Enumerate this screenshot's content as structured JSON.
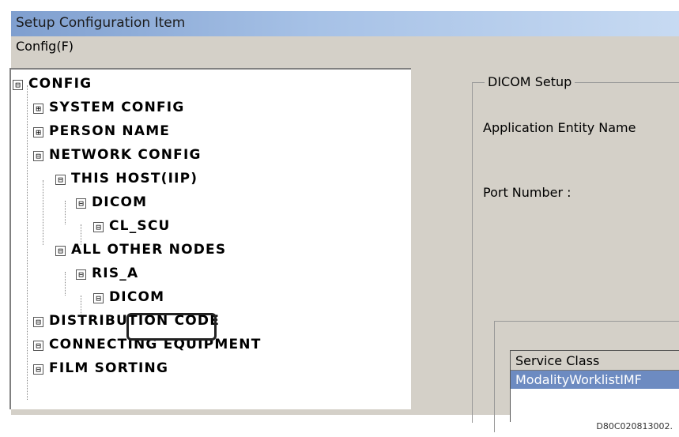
{
  "window": {
    "title": "Setup Configuration Item"
  },
  "menu": {
    "config_label": "Config(F)"
  },
  "tree": {
    "nodes": [
      {
        "label": "CONFIG",
        "expander": "⊟"
      },
      {
        "label": "SYSTEM CONFIG",
        "expander": "⊞"
      },
      {
        "label": "PERSON NAME",
        "expander": "⊞"
      },
      {
        "label": "NETWORK CONFIG",
        "expander": "⊟"
      },
      {
        "label": "THIS HOST(IIP)",
        "expander": "⊟"
      },
      {
        "label": "DICOM",
        "expander": "⊟"
      },
      {
        "label": "CL_SCU",
        "expander": "⊟"
      },
      {
        "label": "ALL OTHER NODES",
        "expander": "⊟"
      },
      {
        "label": "RIS_A",
        "expander": "⊟"
      },
      {
        "label": "DICOM",
        "expander": "⊟"
      },
      {
        "label": "DISTRIBUTION CODE",
        "expander": "⊟"
      },
      {
        "label": "CONNECTING EQUIPMENT",
        "expander": "⊟"
      },
      {
        "label": "FILM SORTING",
        "expander": "⊟"
      }
    ]
  },
  "dicom_setup": {
    "group_title": "DICOM Setup",
    "ae_name_label": "Application Entity Name",
    "port_label": "Port Number :",
    "service_table": {
      "column_header": "Service Class",
      "rows": [
        "ModalityWorklistIMF"
      ]
    }
  },
  "caption": "D80C020813002."
}
